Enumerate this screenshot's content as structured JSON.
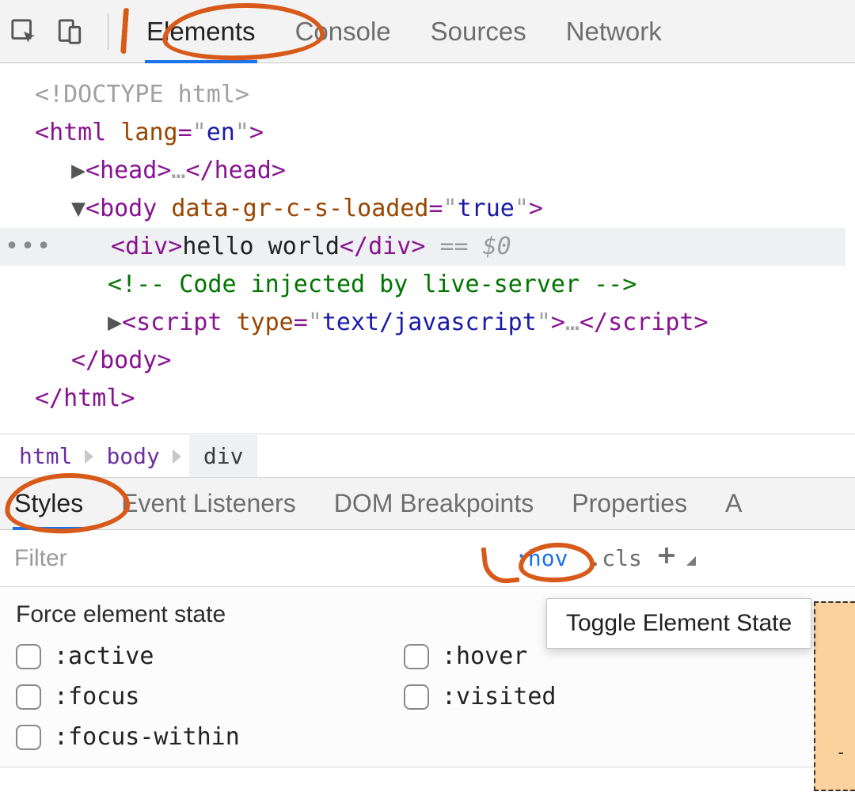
{
  "tabs": {
    "main": [
      "Elements",
      "Console",
      "Sources",
      "Network"
    ],
    "activeMain": 0,
    "sub": [
      "Styles",
      "Event Listeners",
      "DOM Breakpoints",
      "Properties",
      "A"
    ],
    "activeSub": 0
  },
  "dom": {
    "doctype": "<!DOCTYPE html>",
    "html_open": {
      "tag": "html",
      "attr": "lang",
      "val": "en"
    },
    "head": {
      "tag": "head",
      "ellipsis": "…"
    },
    "body_open": {
      "tag": "body",
      "attr": "data-gr-c-s-loaded",
      "val": "true"
    },
    "selected": {
      "tag": "div",
      "text": "hello world",
      "hint": "== $0"
    },
    "comment": "<!-- Code injected by live-server -->",
    "script": {
      "tag": "script",
      "attr": "type",
      "val": "text/javascript",
      "ellipsis": "…"
    },
    "body_close": "body",
    "html_close": "html"
  },
  "breadcrumb": [
    "html",
    "body",
    "div"
  ],
  "filter": {
    "placeholder": "Filter",
    "hov": ":hov",
    "cls": ".cls"
  },
  "tooltip": "Toggle Element State",
  "force": {
    "title": "Force element state",
    "states": [
      ":active",
      ":hover",
      ":focus",
      ":visited",
      ":focus-within"
    ]
  }
}
